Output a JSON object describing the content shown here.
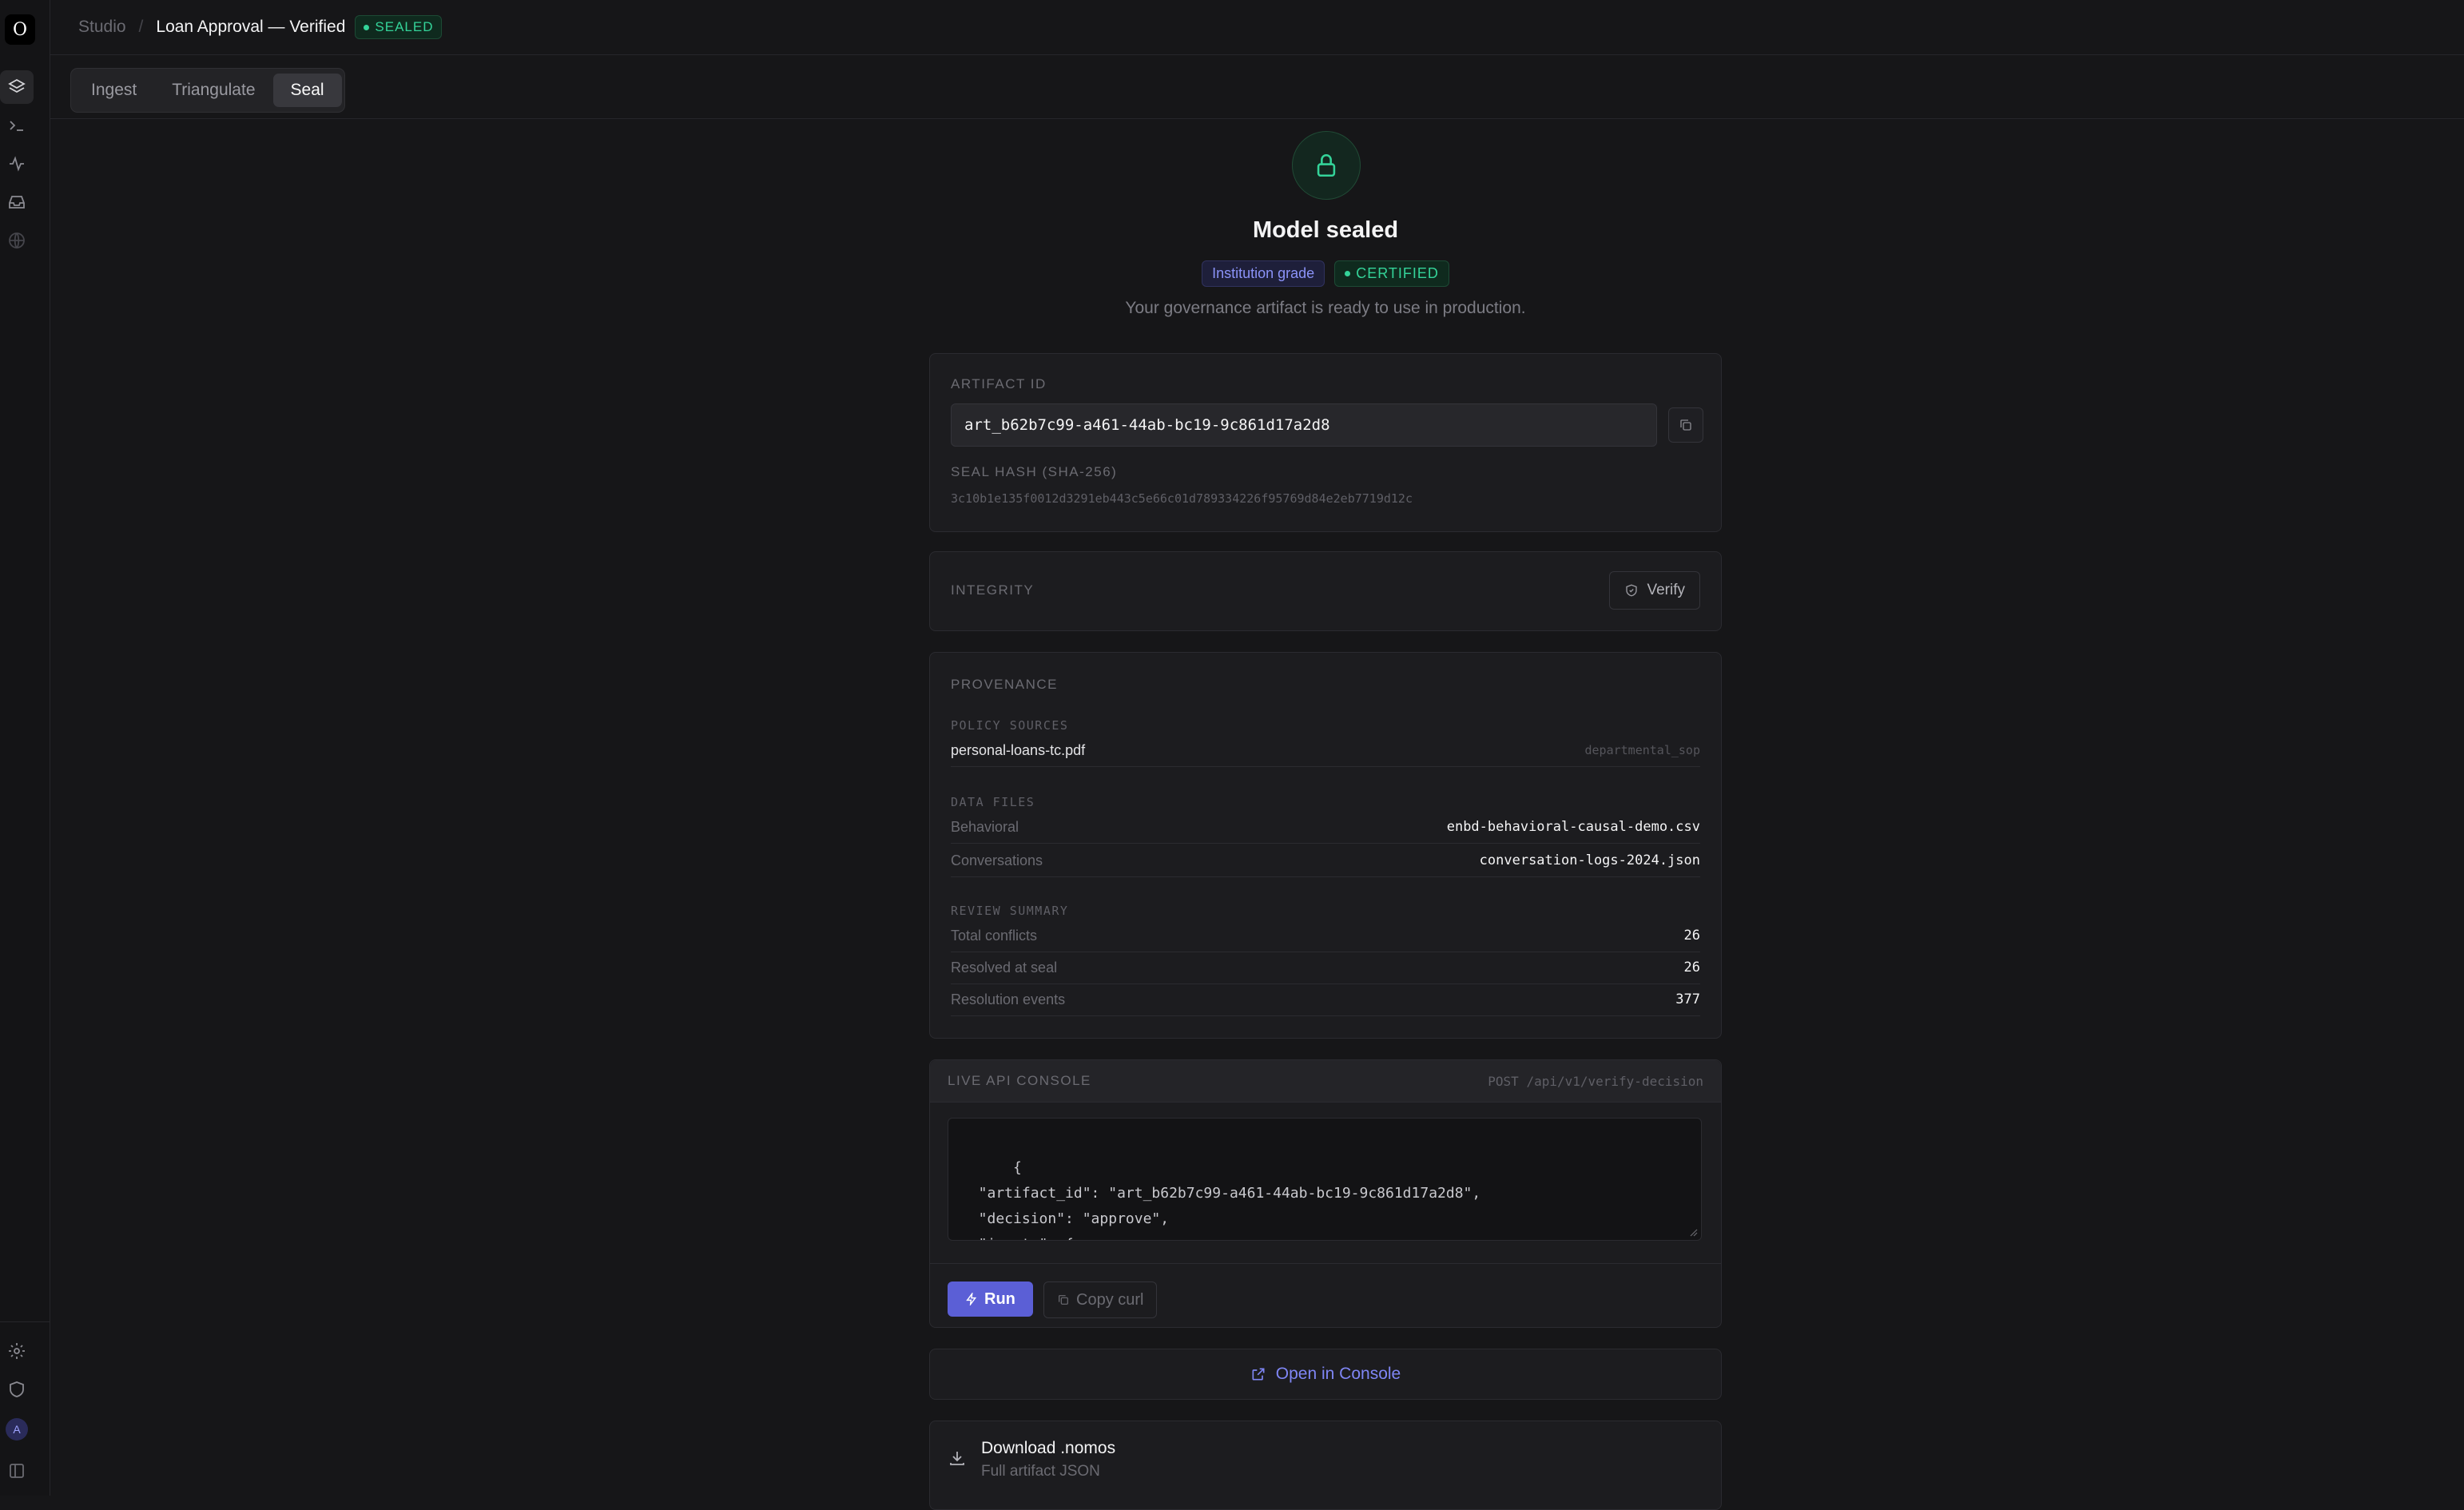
{
  "header": {
    "breadcrumb_root": "Studio",
    "separator": "/",
    "title": "Loan Approval — Verified",
    "status": "SEALED"
  },
  "tabs": [
    {
      "label": "Ingest",
      "active": false
    },
    {
      "label": "Triangulate",
      "active": false
    },
    {
      "label": "Seal",
      "active": true
    }
  ],
  "rail": {
    "logo": "O",
    "avatar_initial": "A",
    "icons": [
      "layers-icon",
      "terminal-icon",
      "activity-icon",
      "inbox-icon",
      "globe-icon",
      "settings-icon",
      "shield-icon",
      "sidebar-toggle-icon"
    ]
  },
  "hero": {
    "title": "Model sealed",
    "grade_badge": "Institution grade",
    "cert_badge": "CERTIFIED",
    "subtitle": "Your governance artifact is ready to use in production."
  },
  "artifact": {
    "id_label": "ARTIFACT ID",
    "id_value": "art_b62b7c99-a461-44ab-bc19-9c861d17a2d8",
    "hash_label": "SEAL HASH (SHA-256)",
    "hash_value": "3c10b1e135f0012d3291eb443c5e66c01d789334226f95769d84e2eb7719d12c"
  },
  "integrity": {
    "label": "INTEGRITY",
    "verify_label": "Verify"
  },
  "provenance": {
    "label": "PROVENANCE",
    "policy_label": "POLICY SOURCES",
    "policy": [
      {
        "name": "personal-loans-tc.pdf",
        "type": "departmental_sop"
      }
    ],
    "data_label": "DATA FILES",
    "data": [
      {
        "kind": "Behavioral",
        "file": "enbd-behavioral-causal-demo.csv"
      },
      {
        "kind": "Conversations",
        "file": "conversation-logs-2024.json"
      }
    ],
    "review_label": "REVIEW SUMMARY",
    "review": [
      {
        "k": "Total conflicts",
        "v": "26"
      },
      {
        "k": "Resolved at seal",
        "v": "26"
      },
      {
        "k": "Resolution events",
        "v": "377"
      }
    ]
  },
  "api": {
    "label": "LIVE API CONSOLE",
    "endpoint": "POST /api/v1/verify-decision",
    "body": "{\n  \"artifact_id\": \"art_b62b7c99-a461-44ab-bc19-9c861d17a2d8\",\n  \"decision\": \"approve\",\n  \"inputs\": {",
    "run_label": "Run",
    "curl_label": "Copy curl"
  },
  "open_console_label": "Open in Console",
  "download": {
    "title": "Download .nomos",
    "subtitle": "Full artifact JSON"
  },
  "colors": {
    "accent": "#5b5fd6",
    "success": "#34d399",
    "background": "#161618"
  }
}
